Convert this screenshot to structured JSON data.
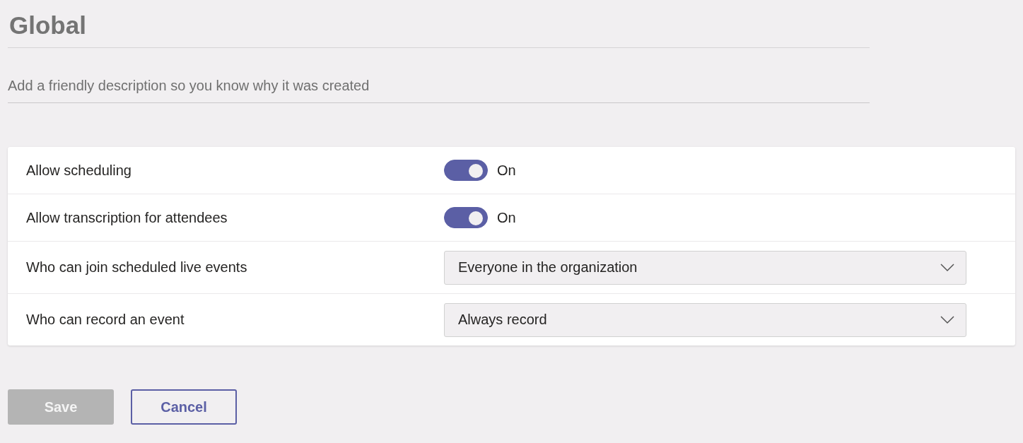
{
  "title": "Global",
  "description": {
    "placeholder": "Add a friendly description so you know why it was created"
  },
  "settings": [
    {
      "kind": "toggle",
      "label": "Allow scheduling",
      "on": true,
      "state_label": "On"
    },
    {
      "kind": "toggle",
      "label": "Allow transcription for attendees",
      "on": true,
      "state_label": "On"
    },
    {
      "kind": "dropdown",
      "label": "Who can join scheduled live events",
      "value": "Everyone in the organization"
    },
    {
      "kind": "dropdown",
      "label": "Who can record an event",
      "value": "Always record"
    }
  ],
  "buttons": [
    {
      "kind": "primary",
      "label": "Save",
      "disabled": true
    },
    {
      "kind": "secondary",
      "label": "Cancel",
      "disabled": false
    }
  ]
}
